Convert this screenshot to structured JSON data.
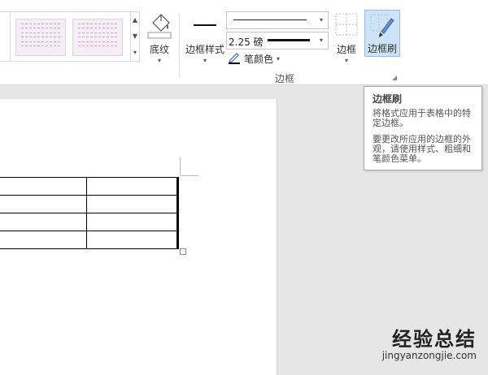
{
  "ribbon": {
    "shading": {
      "label": "底纹",
      "icon": "paint-bucket-icon"
    },
    "border_styles": {
      "label": "边框样式"
    },
    "line_style": {
      "selected": "thin-solid-line"
    },
    "line_weight": {
      "value": "2.25 磅"
    },
    "pen_color": {
      "label": "笔颜色",
      "icon": "pen-icon"
    },
    "borders": {
      "label": "边框",
      "icon": "borders-grid-icon"
    },
    "border_painter": {
      "label": "边框刷",
      "icon": "border-painter-icon"
    },
    "group_label": "边框"
  },
  "tooltip": {
    "title": "边框刷",
    "line1": "将格式应用于表格中的特定边框。",
    "line2": "要更改所应用的边框的外观，请使用样式、粗细和笔颜色菜单。"
  },
  "document": {
    "table_rows": 4,
    "table_cols": 2
  },
  "watermark": {
    "logo": "经验总结",
    "url": "jingyanzongjie.com"
  }
}
